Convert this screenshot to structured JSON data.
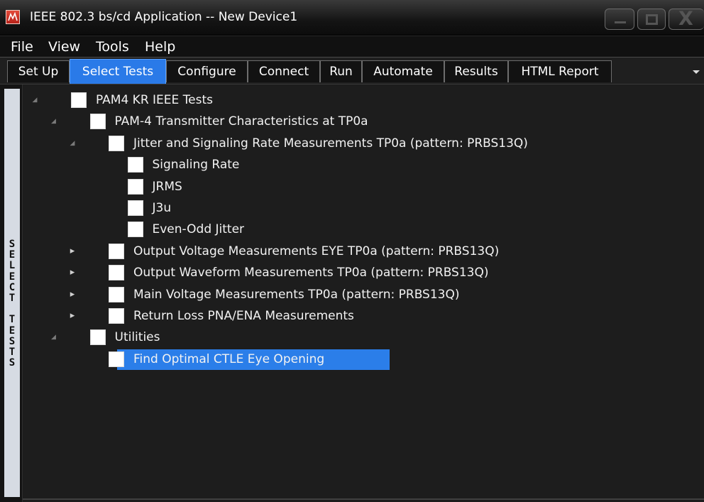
{
  "window": {
    "title": "IEEE 802.3 bs/cd Application -- New Device1",
    "icon": "app-logo-icon",
    "controls": [
      "minimize-icon",
      "maximize-icon",
      "close-icon"
    ],
    "close_glyph": "X"
  },
  "menu": [
    "File",
    "View",
    "Tools",
    "Help"
  ],
  "tabs": [
    {
      "label": "Set Up",
      "active": false
    },
    {
      "label": "Select Tests",
      "active": true
    },
    {
      "label": "Configure",
      "active": false
    },
    {
      "label": "Connect",
      "active": false
    },
    {
      "label": "Run",
      "active": false
    },
    {
      "label": "Automate",
      "active": false
    },
    {
      "label": "Results",
      "active": false
    },
    {
      "label": "HTML Report",
      "active": false
    }
  ],
  "side_panel_label": "SELECT TESTS",
  "tree": [
    {
      "label": "PAM4 KR IEEE Tests",
      "level": 0,
      "expander": "open",
      "checked": false
    },
    {
      "label": "PAM-4 Transmitter Characteristics at TP0a",
      "level": 1,
      "expander": "open",
      "checked": false
    },
    {
      "label": "Jitter and Signaling Rate Measurements TP0a (pattern: PRBS13Q)",
      "level": 2,
      "expander": "open",
      "checked": false
    },
    {
      "label": "Signaling Rate",
      "level": 3,
      "expander": "none",
      "checked": false
    },
    {
      "label": "JRMS",
      "level": 3,
      "expander": "none",
      "checked": false
    },
    {
      "label": "J3u",
      "level": 3,
      "expander": "none",
      "checked": false
    },
    {
      "label": "Even-Odd Jitter",
      "level": 3,
      "expander": "none",
      "checked": false
    },
    {
      "label": "Output Voltage Measurements EYE TP0a (pattern: PRBS13Q)",
      "level": 2,
      "expander": "closed",
      "checked": false
    },
    {
      "label": "Output Waveform Measurements TP0a (pattern: PRBS13Q)",
      "level": 2,
      "expander": "closed",
      "checked": false
    },
    {
      "label": "Main Voltage Measurements TP0a (pattern: PRBS13Q)",
      "level": 2,
      "expander": "closed",
      "checked": false
    },
    {
      "label": "Return Loss PNA/ENA Measurements",
      "level": 2,
      "expander": "closed",
      "checked": false
    },
    {
      "label": "Utilities",
      "level": 1,
      "expander": "open",
      "checked": false
    },
    {
      "label": "Find Optimal CTLE Eye Opening",
      "level": 2,
      "expander": "none",
      "checked": false,
      "selected": true
    }
  ],
  "colors": {
    "accent": "#2b7ee9",
    "background": "#1d1d1d",
    "titlebar": "#141414",
    "brand_icon": "#c8281e"
  }
}
